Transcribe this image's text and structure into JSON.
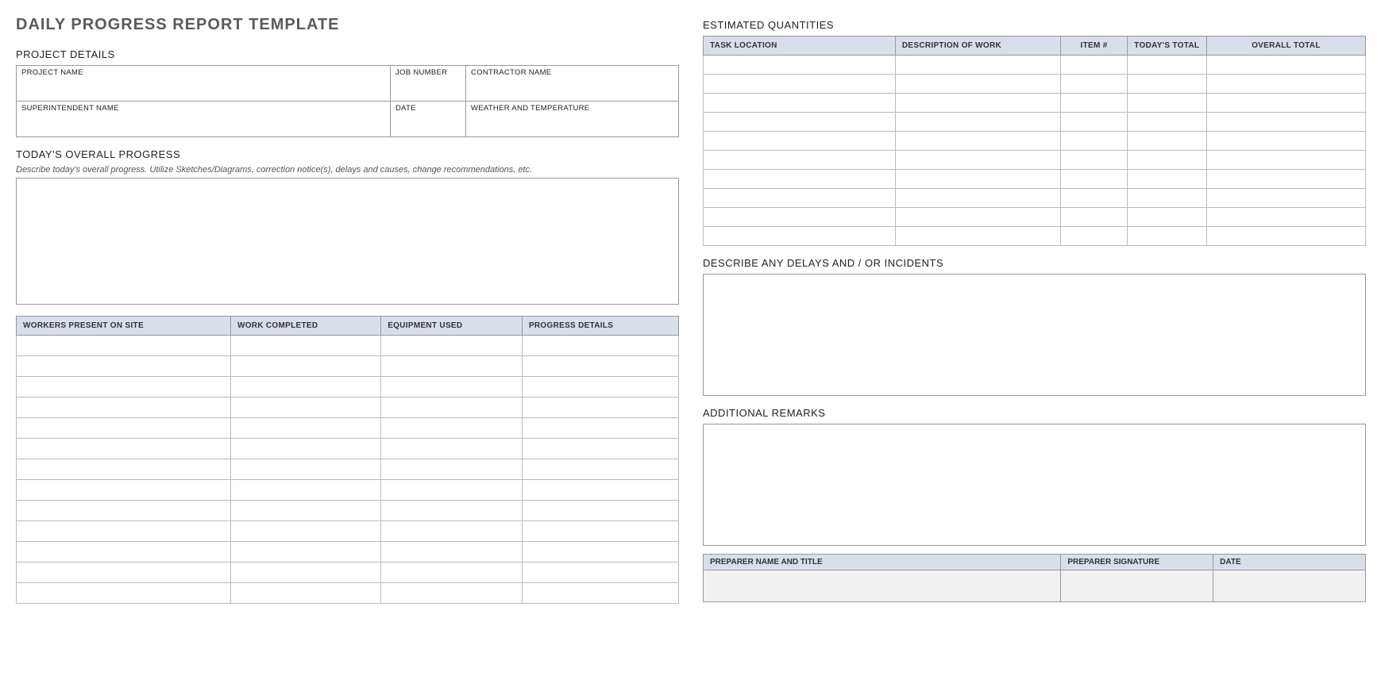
{
  "title": "DAILY PROGRESS REPORT TEMPLATE",
  "project_details": {
    "heading": "PROJECT DETAILS",
    "labels": {
      "project_name": "PROJECT NAME",
      "job_number": "JOB NUMBER",
      "contractor_name": "CONTRACTOR NAME",
      "superintendent_name": "SUPERINTENDENT NAME",
      "date": "DATE",
      "weather": "WEATHER AND TEMPERATURE"
    },
    "values": {
      "project_name": "",
      "job_number": "",
      "contractor_name": "",
      "superintendent_name": "",
      "date": "",
      "weather": ""
    }
  },
  "overall_progress": {
    "heading": "TODAY'S OVERALL PROGRESS",
    "instruction": "Describe today's overall progress.  Utilize Sketches/Diagrams, correction notice(s), delays and causes, change recommendations, etc.",
    "value": ""
  },
  "progress_table": {
    "headers": [
      "WORKERS PRESENT ON SITE",
      "WORK COMPLETED",
      "EQUIPMENT USED",
      "PROGRESS DETAILS"
    ],
    "rows": [
      [
        "",
        "",
        "",
        ""
      ],
      [
        "",
        "",
        "",
        ""
      ],
      [
        "",
        "",
        "",
        ""
      ],
      [
        "",
        "",
        "",
        ""
      ],
      [
        "",
        "",
        "",
        ""
      ],
      [
        "",
        "",
        "",
        ""
      ],
      [
        "",
        "",
        "",
        ""
      ],
      [
        "",
        "",
        "",
        ""
      ],
      [
        "",
        "",
        "",
        ""
      ],
      [
        "",
        "",
        "",
        ""
      ],
      [
        "",
        "",
        "",
        ""
      ],
      [
        "",
        "",
        "",
        ""
      ],
      [
        "",
        "",
        "",
        ""
      ]
    ]
  },
  "estimated_quantities": {
    "heading": "ESTIMATED QUANTITIES",
    "headers": [
      "TASK LOCATION",
      "DESCRIPTION OF WORK",
      "ITEM #",
      "TODAY'S TOTAL",
      "OVERALL TOTAL"
    ],
    "rows": [
      [
        "",
        "",
        "",
        "",
        ""
      ],
      [
        "",
        "",
        "",
        "",
        ""
      ],
      [
        "",
        "",
        "",
        "",
        ""
      ],
      [
        "",
        "",
        "",
        "",
        ""
      ],
      [
        "",
        "",
        "",
        "",
        ""
      ],
      [
        "",
        "",
        "",
        "",
        ""
      ],
      [
        "",
        "",
        "",
        "",
        ""
      ],
      [
        "",
        "",
        "",
        "",
        ""
      ],
      [
        "",
        "",
        "",
        "",
        ""
      ],
      [
        "",
        "",
        "",
        "",
        ""
      ]
    ]
  },
  "delays": {
    "heading": "DESCRIBE ANY DELAYS AND / OR INCIDENTS",
    "value": ""
  },
  "remarks": {
    "heading": "ADDITIONAL REMARKS",
    "value": ""
  },
  "preparer": {
    "headers": [
      "PREPARER NAME AND TITLE",
      "PREPARER SIGNATURE",
      "DATE"
    ],
    "values": [
      "",
      "",
      ""
    ]
  }
}
